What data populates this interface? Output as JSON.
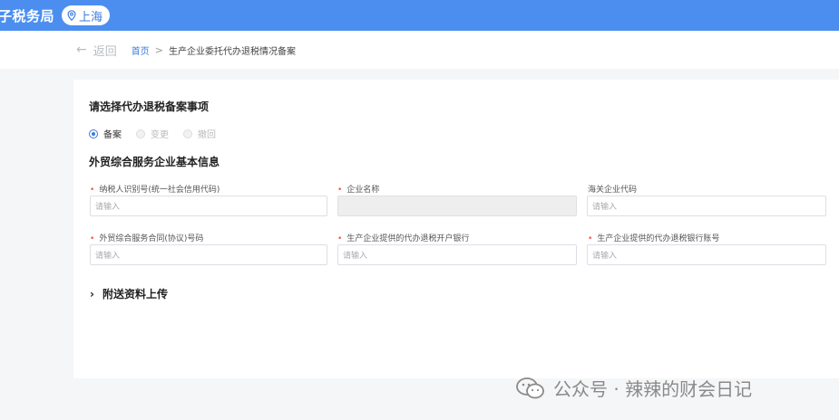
{
  "header": {
    "app_title": "子税务局",
    "region": "上海",
    "region_icon": "location-pin-icon",
    "brand_color": "#4b8ef0"
  },
  "nav": {
    "back_label": "返回",
    "breadcrumb_home": "首页",
    "breadcrumb_separator": ">",
    "breadcrumb_current": "生产企业委托代办退税情况备案"
  },
  "form": {
    "select_section_title": "请选择代办退税备案事项",
    "radio_options": [
      {
        "label": "备案",
        "state": "selected"
      },
      {
        "label": "变更",
        "state": "disabled"
      },
      {
        "label": "撤回",
        "state": "disabled"
      }
    ],
    "basic_info_title": "外贸综合服务企业基本信息",
    "fields": [
      {
        "label": "纳税人识别号(统一社会信用代码)",
        "required": true,
        "placeholder": "请输入",
        "value": ""
      },
      {
        "label": "企业名称",
        "required": true,
        "placeholder": "",
        "value": ""
      },
      {
        "label": "海关企业代码",
        "required": false,
        "placeholder": "请输入",
        "value": ""
      },
      {
        "label": "外贸综合服务合同(协议)号码",
        "required": true,
        "placeholder": "请输入",
        "value": ""
      },
      {
        "label": "生产企业提供的代办退税开户银行",
        "required": true,
        "placeholder": "请输入",
        "value": ""
      },
      {
        "label": "生产企业提供的代办退税银行账号",
        "required": true,
        "placeholder": "请输入",
        "value": ""
      }
    ],
    "attachment_section": "附送资料上传"
  },
  "watermark": {
    "text": "公众号 · 辣辣的财会日记",
    "icon": "wechat-icon"
  }
}
